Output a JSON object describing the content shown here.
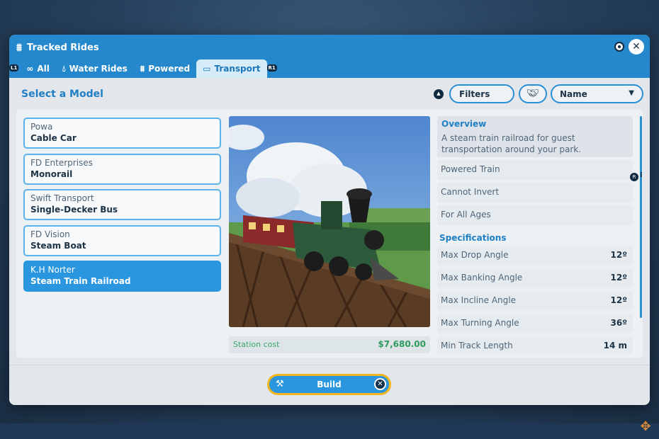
{
  "window": {
    "title": "Tracked Rides",
    "tabs": [
      {
        "label": "All",
        "icon": "infinity-icon",
        "active": false
      },
      {
        "label": "Water Rides",
        "icon": "water-drop-icon",
        "active": false
      },
      {
        "label": "Powered",
        "icon": "track-icon",
        "active": false
      },
      {
        "label": "Transport",
        "icon": "bus-icon",
        "active": true
      }
    ],
    "tab_hints": {
      "left": "L1",
      "right": "R1"
    }
  },
  "header": {
    "title": "Select a Model",
    "filters_label": "Filters",
    "sort_value": "Name"
  },
  "models": [
    {
      "maker": "Powa",
      "name": "Cable Car",
      "selected": false
    },
    {
      "maker": "FD Enterprises",
      "name": "Monorail",
      "selected": false
    },
    {
      "maker": "Swift Transport",
      "name": "Single-Decker Bus",
      "selected": false
    },
    {
      "maker": "FD Vision",
      "name": "Steam Boat",
      "selected": false
    },
    {
      "maker": "K.H Norter",
      "name": "Steam Train Railroad",
      "selected": true
    }
  ],
  "preview": {
    "cost_label": "Station cost",
    "cost_value": "$7,680.00"
  },
  "overview": {
    "title": "Overview",
    "description": "A steam train railroad for guest transportation around your park.",
    "tags": [
      "Powered Train",
      "Cannot Invert",
      "For All Ages"
    ]
  },
  "specifications": {
    "title": "Specifications",
    "rows": [
      {
        "label": "Max Drop Angle",
        "value": "12º"
      },
      {
        "label": "Max Banking Angle",
        "value": "12º"
      },
      {
        "label": "Max Incline Angle",
        "value": "12º"
      },
      {
        "label": "Max Turning Angle",
        "value": "36º"
      },
      {
        "label": "Min Track Length",
        "value": "14 m"
      }
    ]
  },
  "footer": {
    "build_label": "Build"
  },
  "colors": {
    "accent": "#2a96e0",
    "titlebar": "#2588cc",
    "highlight_border": "#f0b51f",
    "cost_green": "#2e9a5e"
  }
}
